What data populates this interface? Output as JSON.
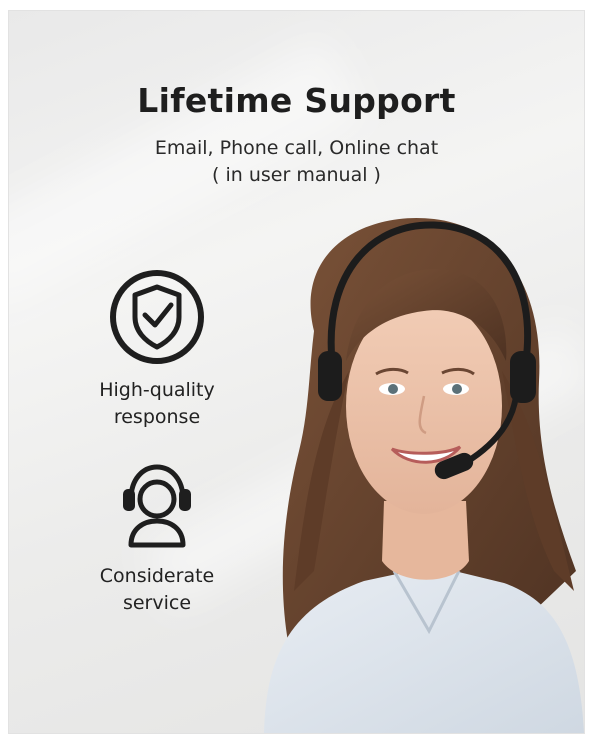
{
  "header": {
    "title": "Lifetime Support",
    "subtitle_line1": "Email, Phone call, Online chat",
    "subtitle_line2": "( in user manual )"
  },
  "features": [
    {
      "icon": "shield-check-icon",
      "line1": "High-quality",
      "line2": "response"
    },
    {
      "icon": "headset-agent-icon",
      "line1": "Considerate",
      "line2": "service"
    }
  ],
  "colors": {
    "text": "#1e1e1e",
    "background": "#eeeeed",
    "shirt": "#dfe6ee",
    "hair": "#6b4630"
  }
}
